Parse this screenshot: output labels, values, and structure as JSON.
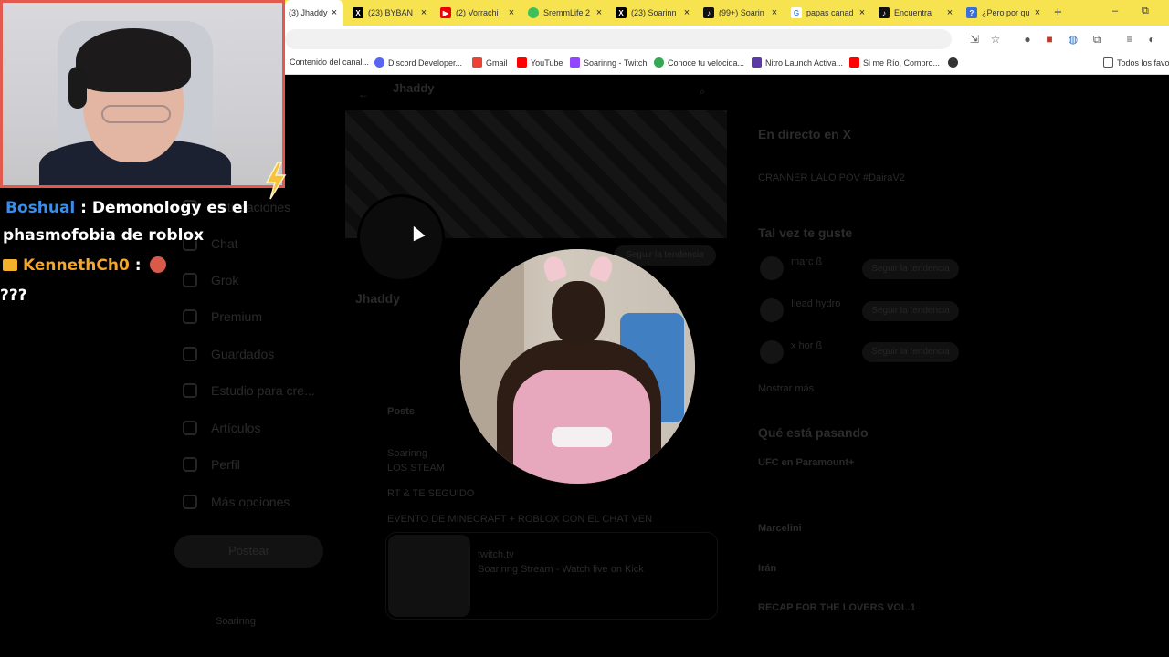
{
  "browser": {
    "tabs": [
      {
        "label": "(3) Jhaddy",
        "favicon": "x-icon",
        "active": true
      },
      {
        "label": "(23) BYBAN",
        "favicon": "x-icon"
      },
      {
        "label": "(2) Vorrachi",
        "favicon": "youtube-icon"
      },
      {
        "label": "SremmLife 2",
        "favicon": "twitch-icon"
      },
      {
        "label": "(23) Soarinn",
        "favicon": "x-icon"
      },
      {
        "label": "(99+) Soarin",
        "favicon": "tiktok-icon"
      },
      {
        "label": "papas canad",
        "favicon": "google-icon"
      },
      {
        "label": "Encuentra",
        "favicon": "tiktok-icon"
      },
      {
        "label": "¿Pero por qu",
        "favicon": "chat-icon"
      }
    ],
    "new_tab": "+",
    "window_buttons": {
      "minimize": "–",
      "restore": "⧉"
    },
    "bookmarks": [
      {
        "label": "Contenido del canal...",
        "color": "#ff0000"
      },
      {
        "label": "Discord Developer...",
        "color": "#5865f2"
      },
      {
        "label": "Gmail",
        "color": "#ea4335"
      },
      {
        "label": "YouTube",
        "color": "#ff0000"
      },
      {
        "label": "Soarinng - Twitch",
        "color": "#9146ff"
      },
      {
        "label": "Conoce tu velocida...",
        "color": "#34a853"
      },
      {
        "label": "Nitro Launch Activa...",
        "color": "#5b3aa8"
      },
      {
        "label": "Si me Río, Compro...",
        "color": "#ff0000"
      },
      {
        "label": "",
        "color": "#333333"
      }
    ],
    "all_bookmarks": "Todos los favor"
  },
  "x_page": {
    "profile_header_name": "Jhaddy",
    "profile_name": "Jhaddy",
    "sidebar": [
      {
        "label": "Notificaciones"
      },
      {
        "label": "Chat"
      },
      {
        "label": "Grok"
      },
      {
        "label": "Premium"
      },
      {
        "label": "Guardados"
      },
      {
        "label": "Estudio para cre..."
      },
      {
        "label": "Artículos"
      },
      {
        "label": "Perfil"
      },
      {
        "label": "Más opciones"
      }
    ],
    "post_button": "Postear",
    "account_name": "Soarinng",
    "follow_button": "Seguir la tendencia",
    "tab_posts": "Posts",
    "post": {
      "author": "Soarinng",
      "line1": "LOS STEAM",
      "line2": "RT & TE SEGUIDO",
      "line3": "EVENTO DE MINECRAFT + ROBLOX CON EL CHAT VEN",
      "card_source": "twitch.tv",
      "card_title": "Soarinng Stream - Watch live on Kick"
    },
    "right": {
      "live_heading": "En directo en X",
      "live_text": "CRANNER LALO POV #DairaV2",
      "suggest_heading": "Tal vez te guste",
      "suggest_names": [
        "marc ß",
        "Ilead hydro",
        "x hor ß"
      ],
      "suggest_button": "Seguir la tendencia",
      "show_more": "Mostrar más",
      "trending_heading": "Qué está pasando",
      "trend1": "UFC en Paramount+",
      "trend2": "Marcelini",
      "trend3": "Irán",
      "trend4": "RECAP FOR THE LOVERS VOL.1"
    }
  },
  "chat": {
    "line1_user": "Boshual",
    "line1_sep": " : ",
    "line1_msg": "Demonology es el",
    "line1_cont": "phasmofobia de roblox",
    "line2_user": "KennethCh0",
    "line2_sep": " : ",
    "line3_msg": "???"
  },
  "colors": {
    "tabbar": "#f7e34f",
    "webcam_border": "#e25a4e",
    "chat_user_blue": "#3a8ee8",
    "chat_user_orange": "#f4a72a"
  }
}
